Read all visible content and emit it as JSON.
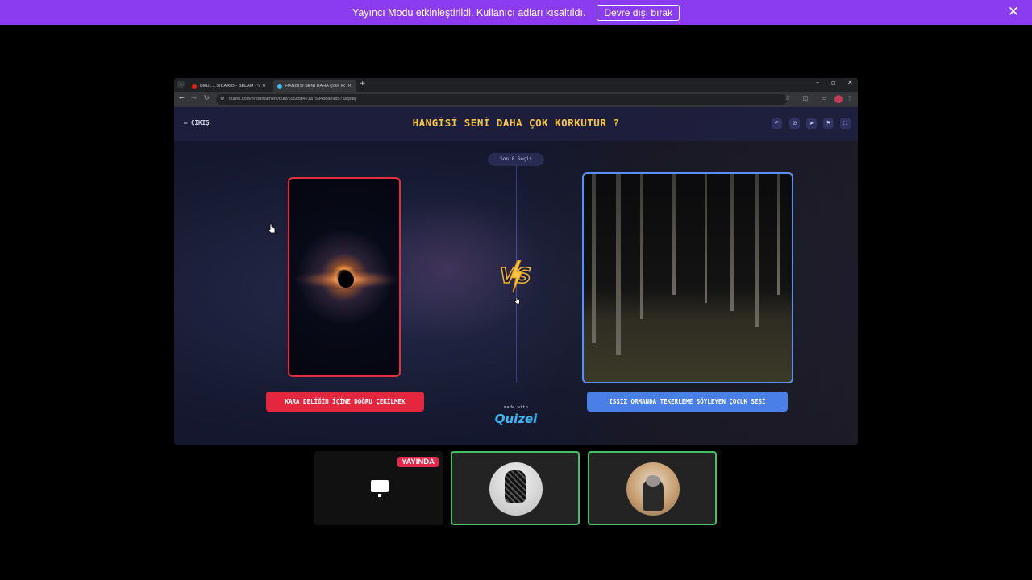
{
  "banner": {
    "message": "Yayıncı Modu etkinleştirildi. Kullanıcı adları kısaltıldı.",
    "disable_label": "Devre dışı bırak",
    "close_icon": "close-icon"
  },
  "browser": {
    "tabs": [
      {
        "label": "DEUL x SICARIO - SELAM - You",
        "favicon": "youtube-icon"
      },
      {
        "label": "HANGİSİ SENİ DAHA ÇOK KORK",
        "favicon": "quizei-icon"
      }
    ],
    "url": "quizei.com/tr/tournament/quiz/695cdb421a75943eae9d57aa/play"
  },
  "page": {
    "back_label": "ÇIKIŞ",
    "title": "HANGİSİ SENİ DAHA ÇOK KORKUTUR ?",
    "header_icons": [
      "undo-icon",
      "link-icon",
      "send-icon",
      "flag-icon",
      "fullscreen-icon"
    ],
    "round_label": "Son 8 Seçiş",
    "vs_label": "VS",
    "left_option": "KARA DELİĞİN İÇİNE DOĞRU ÇEKİLMEK",
    "right_option": "ISSIZ ORMANDA TEKERLEME SÖYLEYEN ÇOCUK SESİ",
    "made_with": "made with",
    "brand": "Quizei"
  },
  "call": {
    "live_label": "YAYINDA"
  },
  "colors": {
    "banner": "#8b3cf0",
    "title": "#f5c542",
    "left_accent": "#e4263f",
    "right_accent": "#4a7fe8",
    "speaking_border": "#46c065",
    "live_badge": "#e2294d"
  }
}
